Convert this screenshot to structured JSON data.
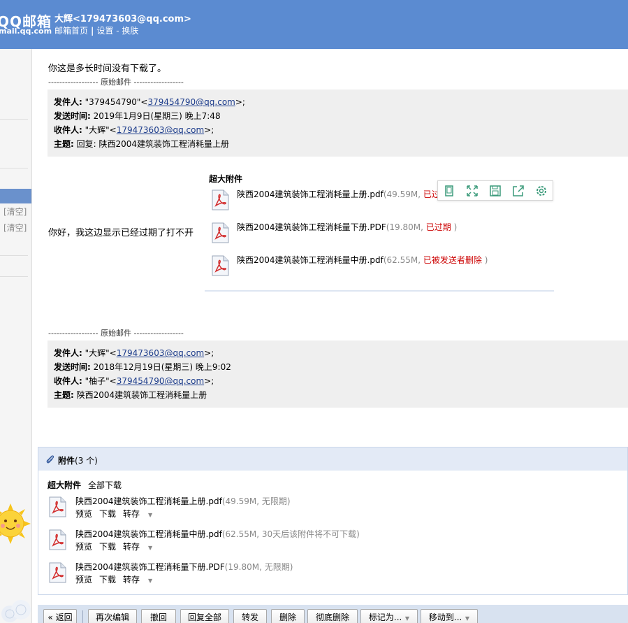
{
  "header": {
    "logo_main": "QQ邮箱",
    "logo_sub": "mail.qq.com",
    "user": "大辉<179473603@qq.com>",
    "nav": {
      "home": "邮箱首页",
      "settings": "设置",
      "dash": "-",
      "skin": "换肤"
    }
  },
  "sidebar": {
    "clear1": "[清空]",
    "clear2": "[清空]"
  },
  "mail": {
    "reply_text": "你这是多长时间没有下载了。",
    "divider1": "------------------ 原始邮件 ------------------",
    "orig1": {
      "from_label": "发件人:",
      "from_name": "\"379454790\"<",
      "from_email": "379454790@qq.com",
      "from_tail": ">;",
      "time_label": "发送时间:",
      "time": "2019年1月9日(星期三) 晚上7:48",
      "to_label": "收件人:",
      "to_name": "\"大辉\"<",
      "to_email": "179473603@qq.com",
      "to_tail": ">;",
      "subject_label": "主题:",
      "subject": "回复: 陕西2004建筑装饰工程消耗量上册"
    },
    "hello_text": "你好，我这边显示已经过期了打不开",
    "inline_attach": {
      "title": "超大附件",
      "items": [
        {
          "name": "陕西2004建筑装饰工程消耗量上册.pdf",
          "size": "(49.59M, ",
          "status": "已过期",
          "tail": " )"
        },
        {
          "name": "陕西2004建筑装饰工程消耗量下册.PDF",
          "size": "(19.80M, ",
          "status": "已过期",
          "tail": " )"
        },
        {
          "name": "陕西2004建筑装饰工程消耗量中册.pdf",
          "size": "(62.55M, ",
          "status": "已被发送者删除",
          "tail": " )"
        }
      ]
    },
    "divider2": "------------------ 原始邮件 ------------------",
    "orig2": {
      "from_label": "发件人:",
      "from_name": "\"大辉\"<",
      "from_email": "179473603@qq.com",
      "from_tail": ">;",
      "time_label": "发送时间:",
      "time": "2018年12月19日(星期三) 晚上9:02",
      "to_label": "收件人:",
      "to_name": "\"柚子\"<",
      "to_email": "379454790@qq.com",
      "to_tail": ">;",
      "subject_label": "主题:",
      "subject": "陕西2004建筑装饰工程消耗量上册"
    }
  },
  "attachments": {
    "title": "附件",
    "count": "(3 个)",
    "section": "超大附件",
    "download_all": "全部下载",
    "items": [
      {
        "name": "陕西2004建筑装饰工程消耗量上册.pdf",
        "meta": "(49.59M, 无限期)"
      },
      {
        "name": "陕西2004建筑装饰工程消耗量中册.pdf",
        "meta": "(62.55M, 30天后该附件将不可下载)"
      },
      {
        "name": "陕西2004建筑装饰工程消耗量下册.PDF",
        "meta": "(19.80M, 无限期)"
      }
    ],
    "actions": {
      "preview": "预览",
      "download": "下载",
      "save": "转存"
    }
  },
  "toolbar": {
    "back": "« 返回",
    "reedit": "再次编辑",
    "recall": "撤回",
    "reply_all": "回复全部",
    "forward": "转发",
    "delete": "删除",
    "delete_perm": "彻底删除",
    "mark_as": "标记为...",
    "move_to": "移动到..."
  },
  "colors": {
    "header": "#5b8bd1",
    "panel_head": "#e3eaf6",
    "expired": "#cc0000",
    "float_icon": "#3a9a7a"
  }
}
